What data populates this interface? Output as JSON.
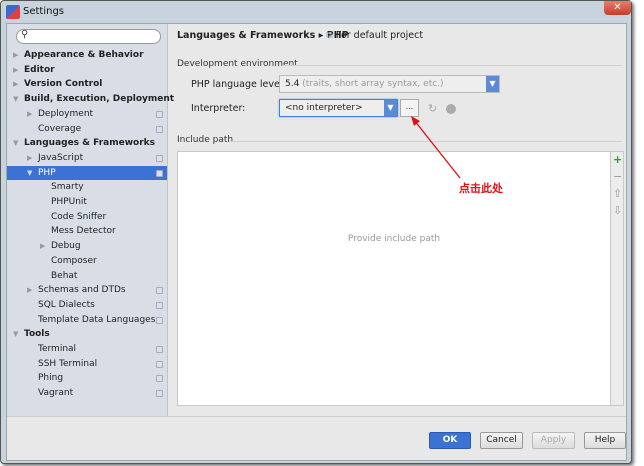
{
  "window": {
    "title": "Settings",
    "close_icon": "close-icon"
  },
  "sidebar": {
    "search_placeholder": "",
    "items": [
      {
        "label": "Appearance & Behavior",
        "level": 0,
        "bold": true,
        "arrow": "right"
      },
      {
        "label": "Editor",
        "level": 0,
        "bold": true,
        "arrow": "right"
      },
      {
        "label": "Version Control",
        "level": 0,
        "bold": true,
        "arrow": "right"
      },
      {
        "label": "Build, Execution, Deployment",
        "level": 0,
        "bold": true,
        "arrow": "down"
      },
      {
        "label": "Deployment",
        "level": 1,
        "arrow": "right",
        "copy": true
      },
      {
        "label": "Coverage",
        "level": 1,
        "copy": true
      },
      {
        "label": "Languages & Frameworks",
        "level": 0,
        "bold": true,
        "arrow": "down"
      },
      {
        "label": "JavaScript",
        "level": 1,
        "arrow": "right",
        "copy": true
      },
      {
        "label": "PHP",
        "level": 1,
        "arrow": "down",
        "copy": true,
        "selected": true
      },
      {
        "label": "Smarty",
        "level": 2
      },
      {
        "label": "PHPUnit",
        "level": 2
      },
      {
        "label": "Code Sniffer",
        "level": 2
      },
      {
        "label": "Mess Detector",
        "level": 2
      },
      {
        "label": "Debug",
        "level": 2,
        "arrow": "right"
      },
      {
        "label": "Composer",
        "level": 2
      },
      {
        "label": "Behat",
        "level": 2
      },
      {
        "label": "Schemas and DTDs",
        "level": 1,
        "arrow": "right",
        "copy": true
      },
      {
        "label": "SQL Dialects",
        "level": 1,
        "copy": true
      },
      {
        "label": "Template Data Languages",
        "level": 1,
        "copy": true
      },
      {
        "label": "Tools",
        "level": 0,
        "bold": true,
        "arrow": "down"
      },
      {
        "label": "Terminal",
        "level": 1,
        "copy": true
      },
      {
        "label": "SSH Terminal",
        "level": 1,
        "copy": true
      },
      {
        "label": "Phing",
        "level": 1,
        "copy": true
      },
      {
        "label": "Vagrant",
        "level": 1,
        "copy": true
      }
    ]
  },
  "main": {
    "breadcrumb": "Languages & Frameworks ▸ PHP",
    "scope": "For default project",
    "dev_env_label": "Development environment",
    "php_level_label": "PHP language level:",
    "php_level_value": "5.4",
    "php_level_hint": "(traits, short array syntax, etc.)",
    "interpreter_label": "Interpreter:",
    "interpreter_value": "<no interpreter>",
    "ellipsis": "...",
    "include_path_label": "Include path",
    "include_placeholder": "Provide include path",
    "tools": {
      "add": "+",
      "remove": "−",
      "up": "⇧",
      "down": "⇩"
    }
  },
  "annotation": {
    "text": "点击此处",
    "color": "#e01010"
  },
  "buttons": {
    "ok": "OK",
    "cancel": "Cancel",
    "apply": "Apply",
    "help": "Help"
  },
  "colors": {
    "accent": "#3b72d4",
    "sidebar_bg": "#d8dde6",
    "add_green": "#2ca02c"
  }
}
